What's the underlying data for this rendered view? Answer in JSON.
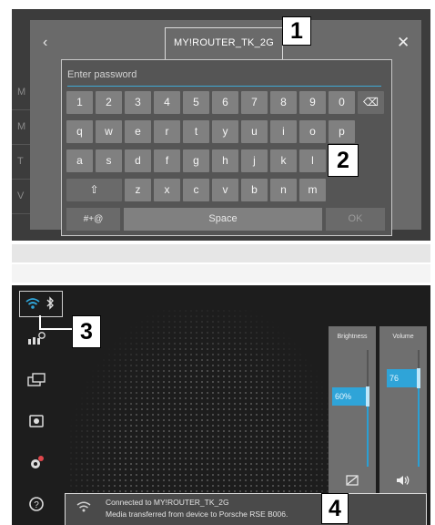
{
  "dialog": {
    "back_icon": "‹",
    "title": "MY!ROUTER_TK_2G",
    "close_icon": "✕",
    "password_placeholder": "Enter password"
  },
  "background_letters": [
    "M",
    "M",
    "T",
    "V"
  ],
  "keyboard": {
    "row1": [
      "1",
      "2",
      "3",
      "4",
      "5",
      "6",
      "7",
      "8",
      "9",
      "0"
    ],
    "backspace": "⌫",
    "row2": [
      "q",
      "w",
      "e",
      "r",
      "t",
      "y",
      "u",
      "i",
      "o",
      "p"
    ],
    "row3": [
      "a",
      "s",
      "d",
      "f",
      "g",
      "h",
      "j",
      "k",
      "l"
    ],
    "shift": "⇧",
    "row4": [
      "z",
      "x",
      "c",
      "v",
      "b",
      "n",
      "m"
    ],
    "symbols": "#+@",
    "space": "Space",
    "ok": "OK"
  },
  "callouts": [
    "1",
    "2",
    "3",
    "4"
  ],
  "statusbar": {
    "wifi_icon": "wifi-icon",
    "bluetooth_icon": "bluetooth-icon"
  },
  "sidebar_icons": [
    "media-icon",
    "screens-icon",
    "camera-icon",
    "settings-icon",
    "help-icon"
  ],
  "brightness": {
    "title": "Brightness",
    "value": "60%",
    "level": 0.6
  },
  "volume": {
    "title": "Volume",
    "value": "76",
    "level": 0.76
  },
  "notification": {
    "line1": "Connected to MY!ROUTER_TK_2G",
    "line2": "Media transferred from device to Porsche RSE B006."
  },
  "colors": {
    "accent": "#2fa4d8",
    "panel": "#3c3c3c",
    "dark_bg": "#1d1d1d"
  }
}
